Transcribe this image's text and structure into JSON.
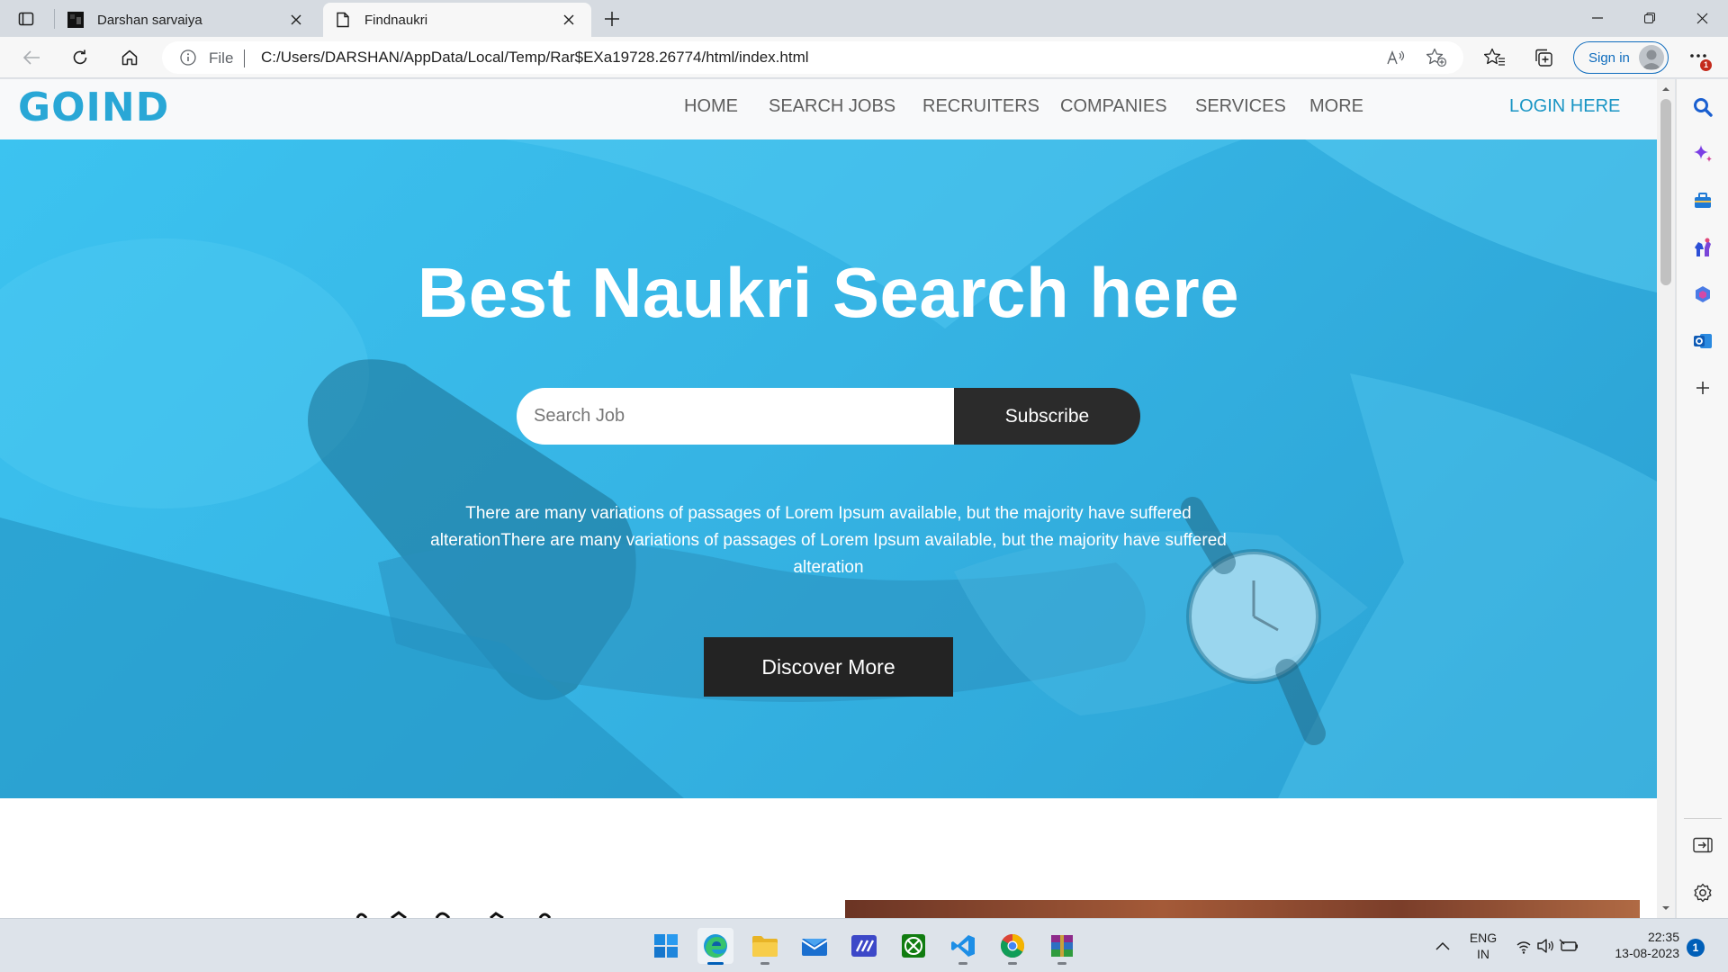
{
  "browser": {
    "tabs": [
      {
        "title": "Darshan sarvaiya",
        "active": false
      },
      {
        "title": "Findnaukri",
        "active": true
      }
    ],
    "address": {
      "scheme_label": "File",
      "url": "C:/Users/DARSHAN/AppData/Local/Temp/Rar$EXa19728.26774/html/index.html"
    },
    "signin_label": "Sign in",
    "notification_badge": "1"
  },
  "site": {
    "logo": "GOIND",
    "nav": [
      "HOME",
      "SEARCH JOBS",
      "RECRUITERS",
      "COMPANIES",
      "SERVICES",
      "MORE"
    ],
    "login_label": "LOGIN HERE",
    "hero": {
      "title": "Best Naukri Search here",
      "search_placeholder": "Search Job",
      "subscribe_label": "Subscribe",
      "description": "There are many variations of passages of Lorem Ipsum available, but the majority have suffered alterationThere are many variations of passages of Lorem Ipsum available, but the majority have suffered alteration",
      "discover_label": "Discover More",
      "accent_color": "#3cc3f0"
    }
  },
  "taskbar": {
    "language": "ENG",
    "region": "IN",
    "time": "22:35",
    "date": "13-08-2023",
    "notifications": "1"
  }
}
